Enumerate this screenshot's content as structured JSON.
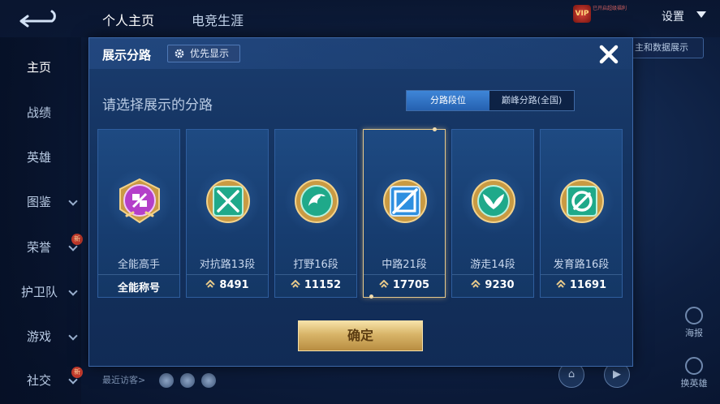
{
  "top_nav": {
    "tabs": [
      "个人主页",
      "电竞生涯"
    ],
    "settings_label": "设置",
    "vip_label": "VIP",
    "vip_note": "已开启超级福利"
  },
  "sidebar": {
    "items": [
      {
        "label": "主页",
        "has_chevron": false,
        "new": false
      },
      {
        "label": "战绩",
        "has_chevron": false,
        "new": false
      },
      {
        "label": "英雄",
        "has_chevron": false,
        "new": false
      },
      {
        "label": "图鉴",
        "has_chevron": true,
        "new": false
      },
      {
        "label": "荣誉",
        "has_chevron": true,
        "new": true
      },
      {
        "label": "护卫队",
        "has_chevron": true,
        "new": false
      },
      {
        "label": "游戏",
        "has_chevron": true,
        "new": false
      },
      {
        "label": "社交",
        "has_chevron": true,
        "new": true
      }
    ],
    "new_badge": "新"
  },
  "right_panel": {
    "chip_label": "主和数据展示",
    "icons": [
      {
        "label": "海报",
        "icon": "poster-icon"
      },
      {
        "label": "换英雄",
        "icon": "swap-hero-icon"
      }
    ]
  },
  "bottom": {
    "recent_visitors_label": "最近访客>"
  },
  "modal": {
    "title": "展示分路",
    "priority_button": "优先显示",
    "subtitle": "请选择展示的分路",
    "toggle": [
      "分路段位",
      "巅峰分路(全国)"
    ],
    "active_toggle_index": 0,
    "confirm_label": "确定",
    "cards": [
      {
        "name": "全能高手",
        "value": "全能称号",
        "has_points": false,
        "emblem": "all-rounder-emblem-icon",
        "color": "#b43fc9",
        "selected": false
      },
      {
        "name": "对抗路13段",
        "value": "8491",
        "has_points": true,
        "emblem": "clash-lane-emblem-icon",
        "color": "#1fa98a",
        "selected": false
      },
      {
        "name": "打野16段",
        "value": "11152",
        "has_points": true,
        "emblem": "jungle-emblem-icon",
        "color": "#1fa98a",
        "selected": false
      },
      {
        "name": "中路21段",
        "value": "17705",
        "has_points": true,
        "emblem": "mid-lane-emblem-icon",
        "color": "#2e8fe0",
        "selected": true
      },
      {
        "name": "游走14段",
        "value": "9230",
        "has_points": true,
        "emblem": "roam-emblem-icon",
        "color": "#1fa98a",
        "selected": false
      },
      {
        "name": "发育路16段",
        "value": "11691",
        "has_points": true,
        "emblem": "farm-lane-emblem-icon",
        "color": "#1fa98a",
        "selected": false
      }
    ]
  },
  "colors": {
    "gold": "#e7c98a",
    "accent_blue": "#3f86d8"
  }
}
